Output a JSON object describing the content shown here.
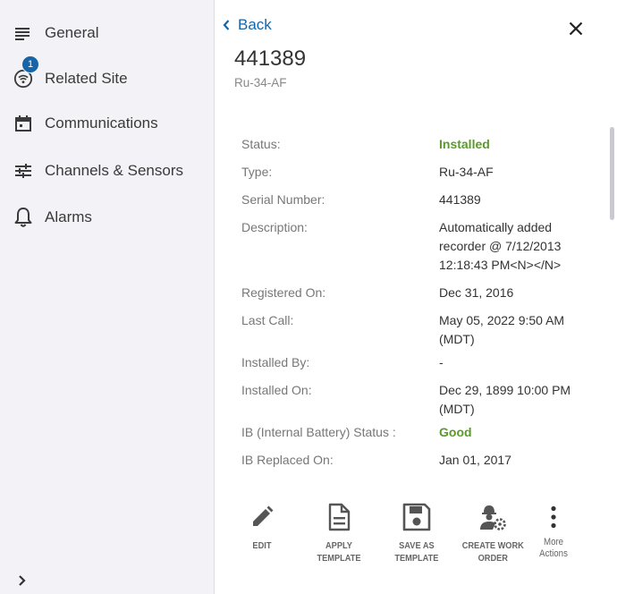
{
  "sidebar": {
    "items": [
      {
        "label": "General",
        "icon": "list-lines-icon"
      },
      {
        "label": "Related Site",
        "icon": "wifi-circle-icon",
        "badge": "1"
      },
      {
        "label": "Communications",
        "icon": "calendar-icon"
      },
      {
        "label": "Channels & Sensors",
        "icon": "sliders-icon"
      },
      {
        "label": "Alarms",
        "icon": "bell-icon"
      }
    ],
    "expand_icon": "chevron-right-icon"
  },
  "header": {
    "back_label": "Back",
    "title": "441389",
    "subtitle": "Ru-34-AF"
  },
  "details": [
    {
      "label": "Status:",
      "value": "Installed",
      "status": "green"
    },
    {
      "label": "Type:",
      "value": "Ru-34-AF"
    },
    {
      "label": "Serial Number:",
      "value": "441389"
    },
    {
      "label": "Description:",
      "value": "Automatically added recorder @ 7/12/2013 12:18:43 PM<N></N>"
    },
    {
      "label": "Registered On:",
      "value": "Dec 31, 2016"
    },
    {
      "label": "Last Call:",
      "value": "May 05, 2022 9:50 AM (MDT)"
    },
    {
      "label": "Installed By:",
      "value": "-"
    },
    {
      "label": "Installed On:",
      "value": "Dec 29, 1899 10:00 PM (MDT)"
    },
    {
      "label": "IB (Internal Battery) Status :",
      "value": "Good",
      "status": "green"
    },
    {
      "label": "IB Replaced On:",
      "value": "Jan 01, 2017"
    }
  ],
  "actions": {
    "edit": "EDIT",
    "apply_template": "APPLY TEMPLATE",
    "save_as_template_1": "SAVE AS",
    "save_as_template_2": "TEMPLATE",
    "create_work_order_1": "CREATE WORK",
    "create_work_order_2": "ORDER",
    "more_actions_1": "More",
    "more_actions_2": "Actions"
  },
  "colors": {
    "accent": "#1565a8",
    "status_green": "#5a9a2a",
    "sidebar_bg": "#f3f3f7"
  }
}
